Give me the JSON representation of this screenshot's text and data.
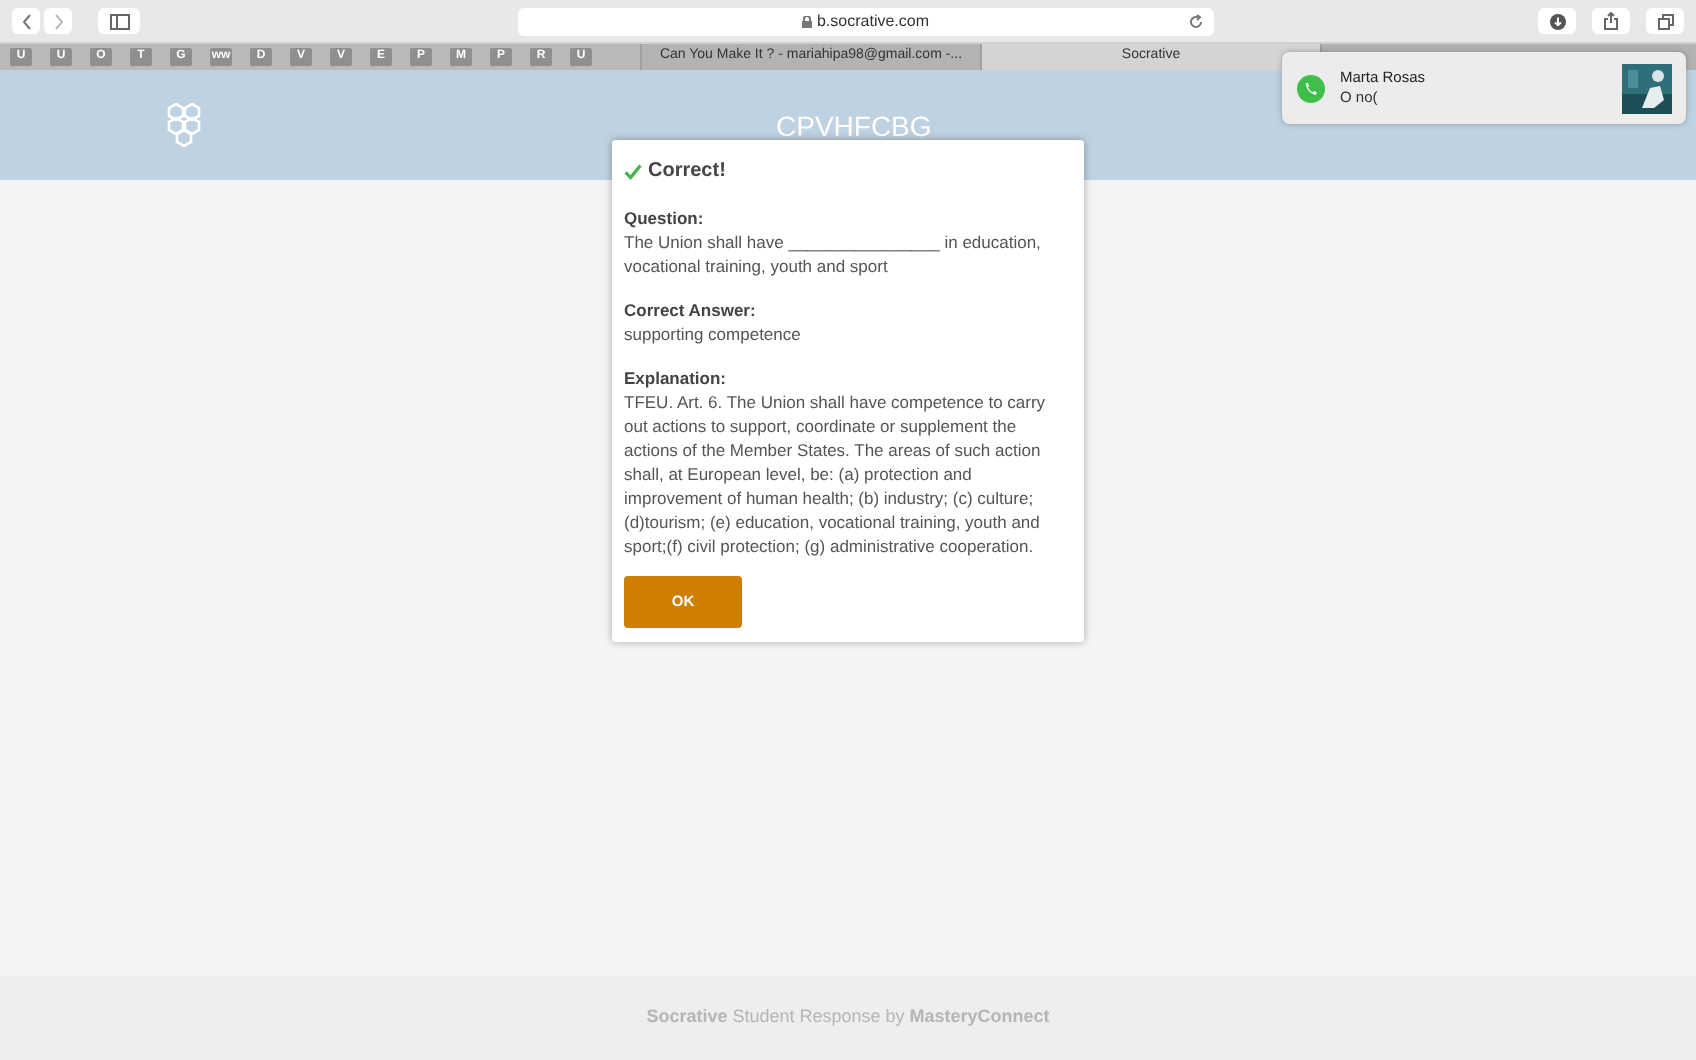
{
  "browser": {
    "address": "b.socrative.com"
  },
  "favorites": [
    {
      "label": "U"
    },
    {
      "label": "U"
    },
    {
      "label": "O"
    },
    {
      "label": "T"
    },
    {
      "label": "G"
    },
    {
      "label": "ww"
    },
    {
      "label": "D"
    },
    {
      "label": "V"
    },
    {
      "label": "V"
    },
    {
      "label": "E"
    },
    {
      "label": "P"
    },
    {
      "label": "M"
    },
    {
      "label": "P"
    },
    {
      "label": "R"
    },
    {
      "label": "U"
    }
  ],
  "tabs": [
    {
      "label": "Can You Make It ? - mariahipa98@gmail.com -...",
      "selected": false
    },
    {
      "label": "Socrative",
      "selected": true
    }
  ],
  "header": {
    "room": "CPVHFCBG"
  },
  "dialog": {
    "title": "Correct!",
    "sections": [
      {
        "heading": "Question:",
        "text": "The Union shall have ________________ in education, vocational training, youth and sport"
      },
      {
        "heading": "Correct Answer:",
        "text": "supporting competence"
      },
      {
        "heading": "Explanation:",
        "text": "TFEU. Art. 6. The Union shall have competence to carry out actions to support, coordinate or supplement the actions of the Member States. The areas of such action shall, at European level, be: (a) protection and improvement of human health; (b) industry; (c) culture; (d)tourism; (e) education, vocational training, youth and sport;(f) civil protection; (g) administrative cooperation."
      }
    ],
    "button": "OK"
  },
  "notification": {
    "sender": "Marta Rosas",
    "message": "O no("
  },
  "footer": "**Socrative** Student Response by **MasteryConnect**"
}
